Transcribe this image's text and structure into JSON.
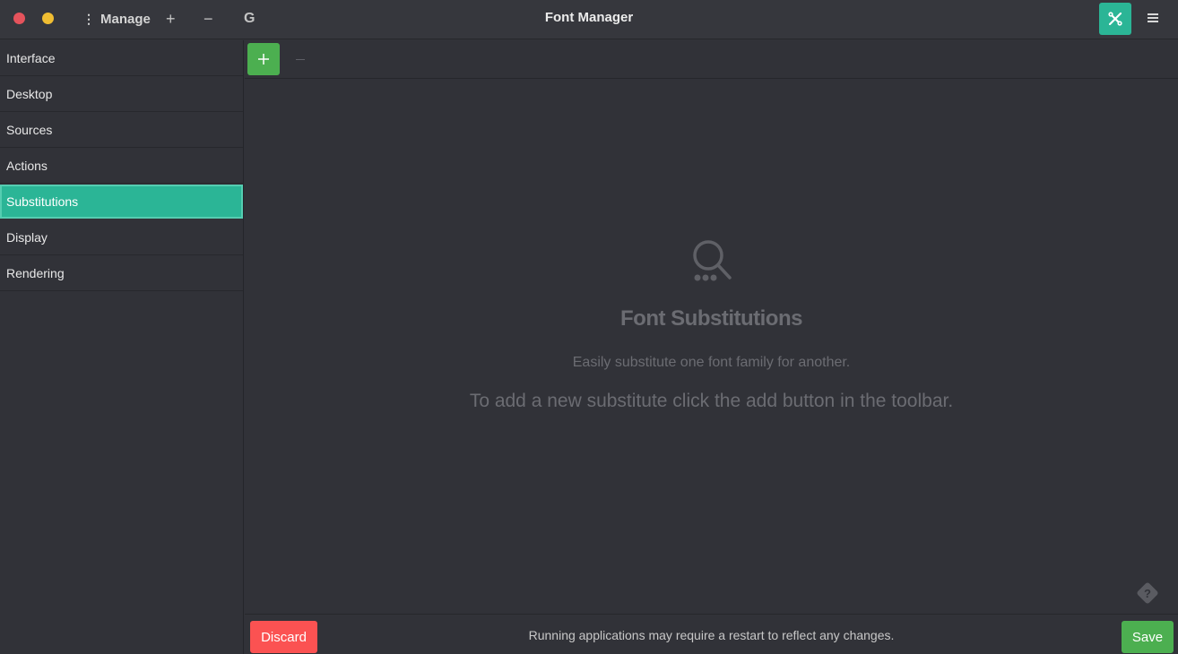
{
  "window": {
    "title": "Font Manager",
    "controls": {
      "close_color": "#e5535c",
      "minimize_color": "#f0bd32"
    }
  },
  "headerbar": {
    "manage_label": "Manage",
    "manage_icon": "vertical-ellipsis-icon",
    "add_glyph": "+",
    "remove_glyph": "−",
    "g_label": "G",
    "tools_icon": "tools-icon",
    "menu_icon": "hamburger-menu-icon",
    "accent": "#2bb596"
  },
  "sidebar": {
    "items": [
      {
        "label": "Interface",
        "active": false
      },
      {
        "label": "Desktop",
        "active": false
      },
      {
        "label": "Sources",
        "active": false
      },
      {
        "label": "Actions",
        "active": false
      },
      {
        "label": "Substitutions",
        "active": true
      },
      {
        "label": "Display",
        "active": false
      },
      {
        "label": "Rendering",
        "active": false
      }
    ]
  },
  "toolbar": {
    "add_icon": "plus-icon",
    "remove_icon": "minus-icon",
    "add_color": "#4caf50"
  },
  "placeholder": {
    "icon": "search-icon",
    "title": "Font Substitutions",
    "subtitle": "Easily substitute one font family for another.",
    "hint": "To add a new substitute click the add button in the toolbar."
  },
  "help": {
    "icon": "help-icon"
  },
  "bottombar": {
    "discard_label": "Discard",
    "status": "Running applications may require a restart to reflect any changes.",
    "save_label": "Save",
    "discard_color": "#fb5252",
    "save_color": "#4caf50"
  }
}
